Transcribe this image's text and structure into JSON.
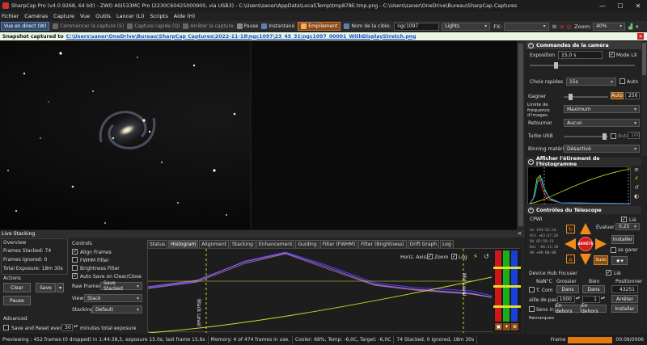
{
  "window": {
    "title": "SharpCap Pro (v4.0.9268, 64 bit) - ZWO ASI533MC Pro (2230C60425000900, via USB3) - C:\\Users\\saner\\AppData\\Local\\Temp\\tmp878E.tmp.png - C:\\Users\\saner\\OneDrive\\Bureau\\SharpCap Captures",
    "controls": [
      "—",
      "☐",
      "✕"
    ]
  },
  "menu": [
    "Fichier",
    "Caméras",
    "Capture",
    "Vue",
    "Outils",
    "Lancer (Li)",
    "Scripts",
    "Aide (H)"
  ],
  "toolbar": {
    "live_view": "Vue en direct (W)",
    "start_capture": "Commencer la capture (S)",
    "quick_capture": "Capture rapide (Q)",
    "stop_capture": "Arrêter la capture",
    "pause": "Pause",
    "snapshot": "Instantané",
    "stacking": "Empilement",
    "target_label": "Nom de la cible:",
    "target_value": "ngc1097",
    "frame_type": "Lights",
    "fx_label": "FX:",
    "fx_value": "",
    "zoom_label": "Zoom:",
    "zoom_value": "40%"
  },
  "snapshot_bar": {
    "prefix": "Snapshot captured to",
    "link": "C:\\Users\\saner\\OneDrive\\Bureau\\SharpCap Captures\\2022-11-18\\ngc1097\\23_45_31\\ngc1097_00001_WithDisplayStretch.png",
    "close": "✕"
  },
  "camera_controls": {
    "header": "Commandes de la caméra",
    "exposure_label": "Exposition",
    "exposure_value": "15,0 s",
    "mode_lx_label": "Mode LX",
    "quick_choice_label": "Choix rapides",
    "quick_choice_value": "15s",
    "auto_label": "Auto",
    "gain_label": "Gagner",
    "gain_auto": "Auto",
    "gain_value": "250",
    "bandwidth_label": "Limite de fréquence d'images",
    "bandwidth_value": "Maximum",
    "flip_label": "Retourner",
    "flip_value": "Aucun",
    "turbo_label": "Turbo USB",
    "turbo_auto": "Auto",
    "turbo_value": "100",
    "binning_label": "Binning matériel",
    "binning_value": "Désactivé"
  },
  "histogram_panel": {
    "header": "Afficher l'étirement de l'histogramme"
  },
  "telescope": {
    "header": "Contrôles du Télescope",
    "mount": "CPWI",
    "evaluate_label": "Évaluer",
    "rate": "0,25",
    "lie_label": "Lié",
    "install_label": "Installer",
    "park_label": "se garer",
    "stop_label": "ARRÊTE",
    "follow_label": "Suivi",
    "coords": [
      "Az  194:52:54",
      "Alt +63:47:26",
      "RA  05:59:11",
      "Dec -66:11:19",
      "HA  +00:00:00"
    ]
  },
  "focuser": {
    "name": "Device Hub Focuser",
    "lie_label": "Lié",
    "temp_label": "NaN°C",
    "coarse_label": "Grossier",
    "fine_label": "Bien",
    "position_label": "Positionner",
    "tcomp_label": "T. Com",
    "in_label": "Dans",
    "in_label2": "Dans",
    "position_value": "43251",
    "step_label": "aille de pas",
    "step_coarse": "1000",
    "step_fine": "1",
    "stop_label": "Arrêter",
    "out_direction_label": "Sens in",
    "out_label": "En dehors",
    "out_label2": "En dehors",
    "install_label": "Installer",
    "remarks_label": "Remarques"
  },
  "live_stacking": {
    "header": "Live Stacking",
    "overview_label": "Overview",
    "frames_stacked": "Frames Stacked: 74",
    "frames_ignored": "Frames Ignored: 0",
    "total_exposure": "Total Exposure: 18m 30s",
    "actions_label": "Actions",
    "clear_label": "Clear",
    "save_label": "Save",
    "pause_label": "Pause",
    "advanced_label": "Advanced",
    "save_reset_label": "Save and Reset every",
    "save_reset_value": "30",
    "minutes_label": "minutes total exposure",
    "controls_label": "Controls",
    "align_frames": "Align Frames",
    "fwhm_filter": "FWHM Filter",
    "brightness_filter": "Brightness Filter",
    "auto_save": "Auto Save on Clear/Close",
    "raw_frames_label": "Raw Frames",
    "raw_frames_value": "Save Stacked",
    "view_label": "View",
    "view_value": "Stack",
    "stacking_label": "Stacking",
    "stacking_value": "Default",
    "tabs": [
      "Status",
      "Histogram",
      "Alignment",
      "Stacking",
      "Enhancement",
      "Guiding",
      "Filter (FWHM)",
      "Filter (Brightness)",
      "Drift Graph",
      "Log"
    ],
    "active_tab": "Histogram",
    "horiz_axis": "Horiz. Axis:",
    "zoom_chk": "Zoom",
    "log_chk": "Log",
    "black_level": "Black Level",
    "mid_level": "Mid Level"
  },
  "statusbar": {
    "preview": "Previewing : 452 frames (0 dropped) in 1:44:38,5, exposure 15.0s, last frame 15.6s",
    "memory": "Memory: 4 of 474 frames in use.",
    "cooler": "Cooler: 68%, Temp: -6,0C, Target: -6,0C",
    "stacked": "74 Stacked, 0 Ignored, 18m 30s",
    "frame_label": "Frame",
    "elapsed": "00:09/0006"
  },
  "colors": {
    "accent_orange": "#e07a10",
    "accent_blue": "#34506e",
    "snapshot_bg": "#e9f6e3",
    "link": "#1b4fcf"
  }
}
